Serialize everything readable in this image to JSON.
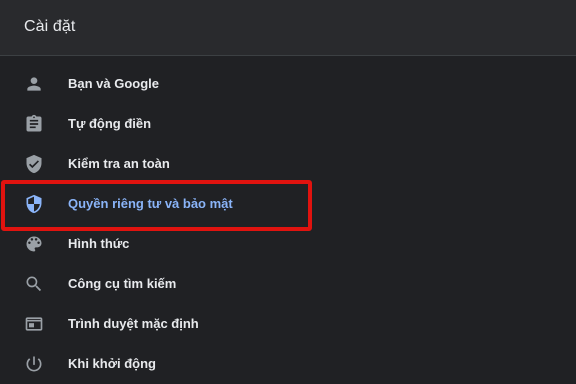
{
  "header": {
    "title": "Cài đặt"
  },
  "nav": {
    "items": [
      {
        "label": "Bạn và Google",
        "icon": "person-icon",
        "selected": false
      },
      {
        "label": "Tự động điền",
        "icon": "clipboard-icon",
        "selected": false
      },
      {
        "label": "Kiểm tra an toàn",
        "icon": "shield-check-icon",
        "selected": false
      },
      {
        "label": "Quyền riêng tư và bảo mật",
        "icon": "shield-icon",
        "selected": true
      },
      {
        "label": "Hình thức",
        "icon": "palette-icon",
        "selected": false
      },
      {
        "label": "Công cụ tìm kiếm",
        "icon": "search-icon",
        "selected": false
      },
      {
        "label": "Trình duyệt mặc định",
        "icon": "browser-icon",
        "selected": false
      },
      {
        "label": "Khi khởi động",
        "icon": "power-icon",
        "selected": false
      }
    ]
  },
  "colors": {
    "background": "#202124",
    "header_background": "#292a2d",
    "text": "#e8eaed",
    "icon": "#9aa0a6",
    "selected": "#8ab4f8",
    "highlight_box": "#e0130f"
  }
}
